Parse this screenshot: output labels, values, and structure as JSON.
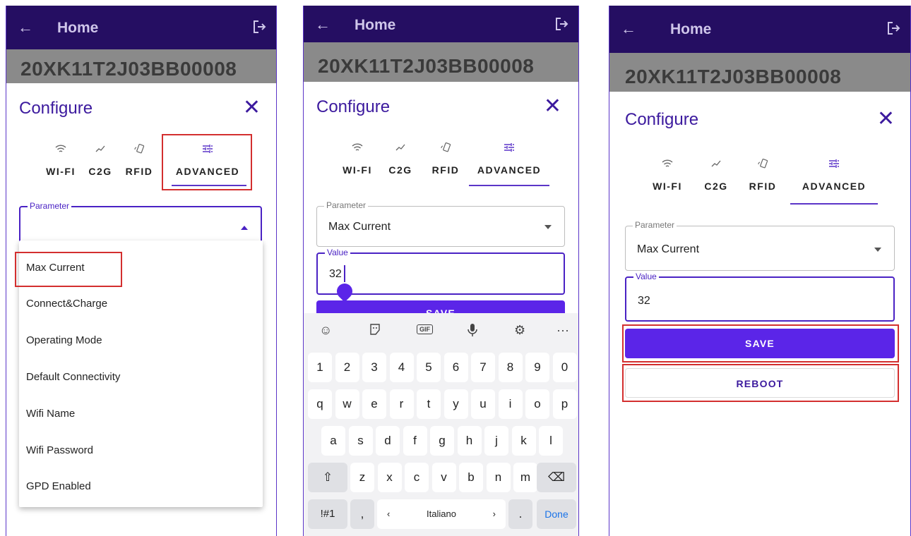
{
  "appbar": {
    "back_icon": "arrow-left-icon",
    "title": "Home",
    "logout_icon": "logout-icon",
    "color": "#250e62"
  },
  "device": {
    "serial": "20XK11T2J03BB00008"
  },
  "configure": {
    "title": "Configure",
    "close_icon": "close-icon",
    "tabs": [
      {
        "label": "WI-FI",
        "icon": "wifi-icon"
      },
      {
        "label": "C2G",
        "icon": "chart-line-icon"
      },
      {
        "label": "RFID",
        "icon": "rfid-card-icon"
      },
      {
        "label": "ADVANCED",
        "icon": "tune-icon",
        "selected": true
      }
    ]
  },
  "screen1": {
    "parameter_label": "Parameter",
    "parameter_value": "",
    "dropdown_options": [
      "Max Current",
      "Connect&Charge",
      "Operating Mode",
      "Default Connectivity",
      "Wifi Name",
      "Wifi Password",
      "GPD Enabled"
    ]
  },
  "screen2": {
    "parameter_label": "Parameter",
    "parameter_value": "Max Current",
    "value_label": "Value",
    "value": "32",
    "save_label": "SAVE",
    "keyboard": {
      "toolbar_icons": [
        "emoji-icon",
        "sticker-icon",
        "gif-icon",
        "microphone-icon",
        "settings-icon",
        "more-icon"
      ],
      "gif_label": "GIF",
      "more_label": "···",
      "row_numbers": [
        "1",
        "2",
        "3",
        "4",
        "5",
        "6",
        "7",
        "8",
        "9",
        "0"
      ],
      "row_q": [
        "q",
        "w",
        "e",
        "r",
        "t",
        "y",
        "u",
        "i",
        "o",
        "p"
      ],
      "row_a": [
        "a",
        "s",
        "d",
        "f",
        "g",
        "h",
        "j",
        "k",
        "l"
      ],
      "row_z": [
        "z",
        "x",
        "c",
        "v",
        "b",
        "n",
        "m"
      ],
      "symbols_label": "!#1",
      "comma_label": ",",
      "space_label": "Italiano",
      "space_left": "‹",
      "space_right": "›",
      "period_label": ".",
      "done_label": "Done"
    }
  },
  "screen3": {
    "parameter_label": "Parameter",
    "parameter_value": "Max Current",
    "value_label": "Value",
    "value": "32",
    "save_label": "SAVE",
    "reboot_label": "REBOOT"
  },
  "colors": {
    "accent": "#5b25e8",
    "title_purple": "#3c1a9e",
    "highlight_red": "#d32f2f"
  }
}
